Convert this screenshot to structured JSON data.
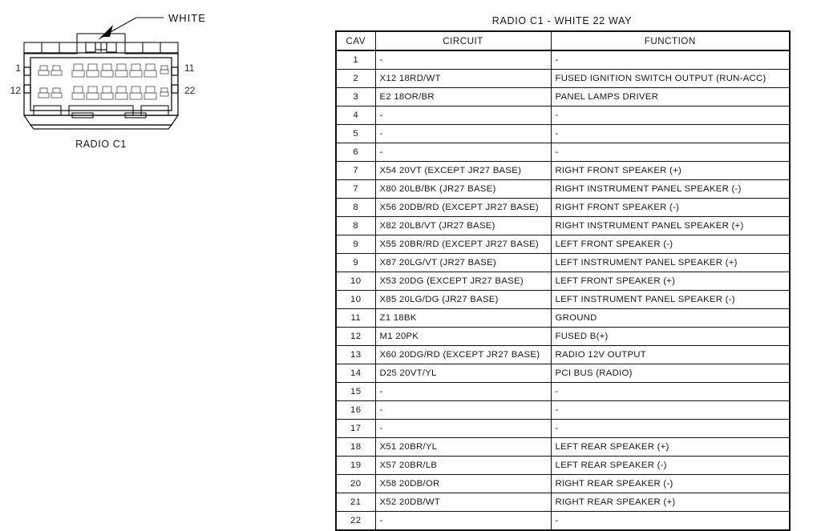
{
  "diagram": {
    "callout_label": "WHITE",
    "caption": "RADIO C1",
    "pin_top_left": "1",
    "pin_bottom_left": "12",
    "pin_top_right": "11",
    "pin_bottom_right": "22",
    "line_color": "#111111",
    "arrow_color": "#000000"
  },
  "table": {
    "title": "RADIO C1 - WHITE 22 WAY",
    "headers": {
      "cav": "CAV",
      "circuit": "CIRCUIT",
      "function": "FUNCTION"
    },
    "rows": [
      {
        "cav": "1",
        "circuit": "-",
        "function": "-"
      },
      {
        "cav": "2",
        "circuit": "X12 18RD/WT",
        "function": "FUSED IGNITION SWITCH OUTPUT (RUN-ACC)"
      },
      {
        "cav": "3",
        "circuit": "E2 18OR/BR",
        "function": "PANEL LAMPS DRIVER"
      },
      {
        "cav": "4",
        "circuit": "-",
        "function": "-"
      },
      {
        "cav": "5",
        "circuit": "-",
        "function": "-"
      },
      {
        "cav": "6",
        "circuit": "-",
        "function": "-"
      },
      {
        "cav": "7",
        "circuit": "X54 20VT (EXCEPT JR27 BASE)",
        "function": "RIGHT FRONT SPEAKER (+)"
      },
      {
        "cav": "7",
        "circuit": "X80 20LB/BK (JR27 BASE)",
        "function": "RIGHT INSTRUMENT PANEL SPEAKER (-)"
      },
      {
        "cav": "8",
        "circuit": "X56 20DB/RD (EXCEPT JR27 BASE)",
        "function": "RIGHT FRONT SPEAKER (-)"
      },
      {
        "cav": "8",
        "circuit": "X82 20LB/VT (JR27 BASE)",
        "function": "RIGHT INSTRUMENT PANEL SPEAKER (+)"
      },
      {
        "cav": "9",
        "circuit": "X55 20BR/RD (EXCEPT JR27 BASE)",
        "function": "LEFT FRONT SPEAKER (-)"
      },
      {
        "cav": "9",
        "circuit": "X87 20LG/VT (JR27 BASE)",
        "function": "LEFT INSTRUMENT PANEL SPEAKER (+)"
      },
      {
        "cav": "10",
        "circuit": "X53 20DG (EXCEPT JR27 BASE)",
        "function": "LEFT FRONT SPEAKER (+)"
      },
      {
        "cav": "10",
        "circuit": "X85 20LG/DG (JR27 BASE)",
        "function": "LEFT INSTRUMENT PANEL SPEAKER (-)"
      },
      {
        "cav": "11",
        "circuit": "Z1 18BK",
        "function": "GROUND"
      },
      {
        "cav": "12",
        "circuit": "M1 20PK",
        "function": "FUSED B(+)"
      },
      {
        "cav": "13",
        "circuit": "X60 20DG/RD (EXCEPT JR27 BASE)",
        "function": "RADIO 12V OUTPUT"
      },
      {
        "cav": "14",
        "circuit": "D25 20VT/YL",
        "function": "PCI BUS (RADIO)"
      },
      {
        "cav": "15",
        "circuit": "-",
        "function": "-"
      },
      {
        "cav": "16",
        "circuit": "-",
        "function": "-"
      },
      {
        "cav": "17",
        "circuit": "-",
        "function": "-"
      },
      {
        "cav": "18",
        "circuit": "X51 20BR/YL",
        "function": "LEFT REAR SPEAKER (+)"
      },
      {
        "cav": "19",
        "circuit": "X57 20BR/LB",
        "function": "LEFT REAR SPEAKER (-)"
      },
      {
        "cav": "20",
        "circuit": "X58 20DB/OR",
        "function": "RIGHT REAR SPEAKER (-)"
      },
      {
        "cav": "21",
        "circuit": "X52 20DB/WT",
        "function": "RIGHT REAR SPEAKER (+)"
      },
      {
        "cav": "22",
        "circuit": "-",
        "function": "-"
      }
    ]
  }
}
